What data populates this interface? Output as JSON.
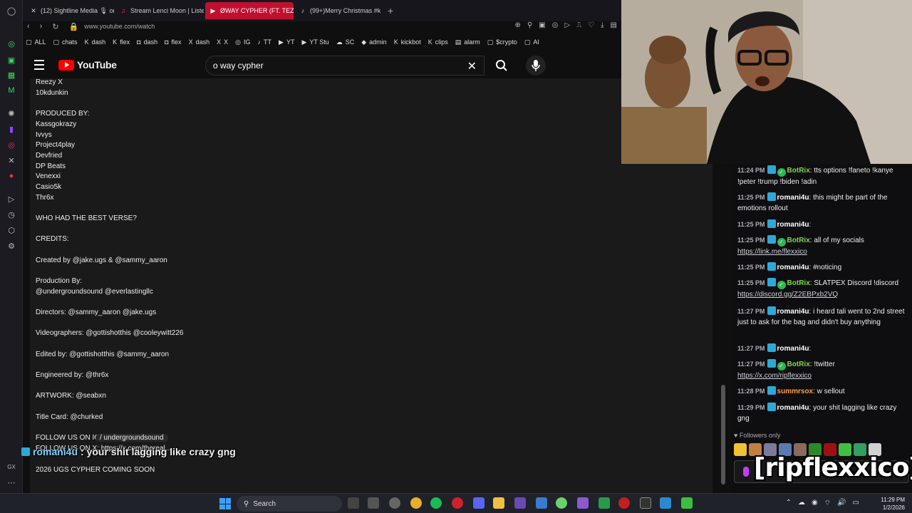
{
  "browser": {
    "tabs": [
      {
        "label": "(12) Sightline Media 🎙 on",
        "icon": "x-icon",
        "active": false
      },
      {
        "label": "Stream Lenci Moon | Liste",
        "icon": "music-icon",
        "active": false
      },
      {
        "label": "ØWAY CYPHER (FT. TEZ",
        "icon": "youtube-icon",
        "active": true
      },
      {
        "label": "(99+)Merry Christmas #k",
        "icon": "tiktok-icon",
        "active": false
      }
    ],
    "url": "www.youtube.com/watch",
    "bookmarks": [
      {
        "label": "ALL",
        "icon": "▢"
      },
      {
        "label": "chats",
        "icon": "▢"
      },
      {
        "label": "dash",
        "icon": "K"
      },
      {
        "label": "flex",
        "icon": "K"
      },
      {
        "label": "dash",
        "icon": "◘"
      },
      {
        "label": "flex",
        "icon": "◘"
      },
      {
        "label": "dash",
        "icon": "X"
      },
      {
        "label": "X",
        "icon": "X"
      },
      {
        "label": "IG",
        "icon": "◎"
      },
      {
        "label": "TT",
        "icon": "♪"
      },
      {
        "label": "YT",
        "icon": "▶"
      },
      {
        "label": "YT Stu",
        "icon": "▶"
      },
      {
        "label": "SC",
        "icon": "☁"
      },
      {
        "label": "admin",
        "icon": "◆"
      },
      {
        "label": "kickbot",
        "icon": "K"
      },
      {
        "label": "clips",
        "icon": "K"
      },
      {
        "label": "alarm",
        "icon": "▤"
      },
      {
        "label": "$crypto",
        "icon": "▢"
      },
      {
        "label": "AI",
        "icon": "▢"
      }
    ]
  },
  "youtube": {
    "logo_text": "YouTube",
    "search_value": "o way cypher"
  },
  "description": {
    "lines": [
      {
        "text": "Reezy X",
        "style": "normal"
      },
      {
        "text": "10kdunkin",
        "style": "normal"
      },
      {
        "text": "PRODUCED BY:",
        "style": "normal"
      },
      {
        "text": "Kassgokrazy",
        "style": "normal"
      },
      {
        "text": "Ivvys",
        "style": "normal"
      },
      {
        "text": "Project4play",
        "style": "normal"
      },
      {
        "text": "Devfried",
        "style": "normal"
      },
      {
        "text": "DP Beats",
        "style": "normal"
      },
      {
        "text": "Venexxi",
        "style": "normal"
      },
      {
        "text": "Casio5k",
        "style": "normal"
      },
      {
        "text": "Thr6x",
        "style": "normal"
      },
      {
        "text": "WHO HAD THE BEST VERSE?",
        "style": "normal"
      },
      {
        "text": "CREDITS:",
        "style": "normal"
      },
      {
        "text": "Created by @jake.ugs & @sammy_aaron",
        "style": "normal"
      },
      {
        "text": "Production By:",
        "style": "normal"
      },
      {
        "text": "@undergroundsound @everlastingllc",
        "style": "normal"
      },
      {
        "text": "Directors: @sammy_aaron @jake.ugs",
        "style": "normal"
      },
      {
        "text": "Videographers: @gottishotthis @cooleywitt226",
        "style": "normal"
      },
      {
        "text": "Edited by: @gottishotthis @sammy_aaron",
        "style": "normal"
      },
      {
        "text": "Engineered by: @thr6x",
        "style": "normal"
      },
      {
        "text": "ARTWORK: @seabxn",
        "style": "normal"
      },
      {
        "text": "Title Card: @churked",
        "style": "normal"
      },
      {
        "text": "FOLLOW US ON IG:",
        "style": "normal"
      },
      {
        "text": "2026 UGS CYPHER COMING SOON",
        "style": "normal"
      }
    ],
    "ig_handle": " / undergroundsound",
    "follow_x": "FOLLOW US ON X:",
    "follow_x_link": "https://x.com/thereal..."
  },
  "overlay": {
    "username": "romani4u",
    "message": ": your shit lagging like crazy gng"
  },
  "chat": {
    "messages": [
      {
        "time": "11:24 PM",
        "user": "BotRix",
        "bot": true,
        "text": "tts options !faneto !kanye !peter !trump !biden !adin",
        "link": ""
      },
      {
        "time": "11:25 PM",
        "user": "romani4u",
        "bot": false,
        "text": "this might be part of the emotions rollout",
        "link": ""
      },
      {
        "time": "11:25 PM",
        "user": "romani4u",
        "bot": false,
        "text": "",
        "link": ""
      },
      {
        "time": "11:25 PM",
        "user": "BotRix",
        "bot": true,
        "text": "all of my socials",
        "link": "https://link.me/flexxico"
      },
      {
        "time": "11:25 PM",
        "user": "romani4u",
        "bot": false,
        "text": "#noticing",
        "link": ""
      },
      {
        "time": "11:25 PM",
        "user": "BotRix",
        "bot": true,
        "text": "SLATPEX Discord !discord",
        "link": "https://discord.gg/Z2EBPxb2VQ"
      },
      {
        "time": "11:27 PM",
        "user": "romani4u",
        "bot": false,
        "text": "i heard tali went to 2nd street just to ask for the bag and didn't buy anything",
        "link": ""
      },
      {
        "time": "11:27 PM",
        "user": "romani4u",
        "bot": false,
        "text": "",
        "link": ""
      },
      {
        "time": "11:27 PM",
        "user": "BotRix",
        "bot": true,
        "text": "!twitter",
        "link": "https://x.com/ripflexxico"
      },
      {
        "time": "11:28 PM",
        "user": "summrsox",
        "bot": false,
        "text": "w sellout",
        "link": ""
      },
      {
        "time": "11:29 PM",
        "user": "romani4u",
        "bot": false,
        "text": "your shit lagging like crazy gng",
        "link": ""
      }
    ],
    "followers_only": "Followers only",
    "brand": "[ripflexxico]"
  },
  "taskbar": {
    "search_label": "Search",
    "time": "11:29 PM",
    "date": "1/2/2026"
  },
  "colors": {
    "youtube_red": "#ff0000",
    "active_tab": "#c01030",
    "bot_name": "#7cd84a",
    "user_name": "#ffffff",
    "summrsox_name": "#ff9f40"
  }
}
